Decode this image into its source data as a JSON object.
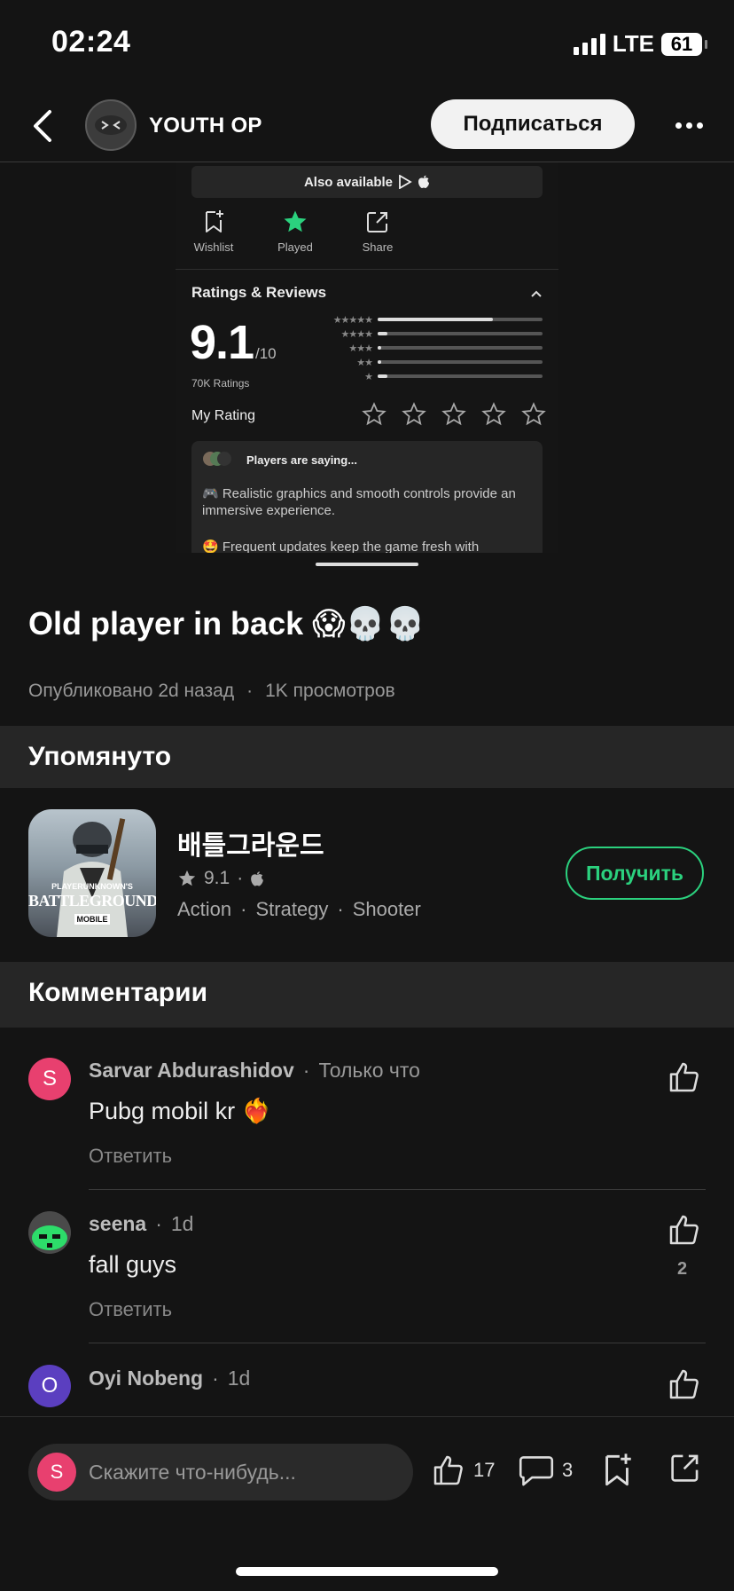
{
  "status_bar": {
    "time": "02:24",
    "network": "LTE",
    "battery": "61"
  },
  "header": {
    "channel_name": "YOUTH OP",
    "subscribe_label": "Подписаться"
  },
  "embed": {
    "also_available": "Also available",
    "actions": [
      {
        "label": "Wishlist",
        "icon": "bookmark-plus-icon"
      },
      {
        "label": "Played",
        "icon": "star-filled-icon"
      },
      {
        "label": "Share",
        "icon": "share-icon"
      }
    ],
    "ratings_title": "Ratings & Reviews",
    "score": "9.1",
    "score_of": "/10",
    "ratings_count": "70K  Ratings",
    "bars": [
      {
        "stars": "★★★★★",
        "fraction": 0.7
      },
      {
        "stars": "★★★★",
        "fraction": 0.06
      },
      {
        "stars": "★★★",
        "fraction": 0.02
      },
      {
        "stars": "★★",
        "fraction": 0.02
      },
      {
        "stars": "★",
        "fraction": 0.06
      }
    ],
    "my_rating_label": "My Rating",
    "players_saying": "Players are saying...",
    "saying_1": "🎮 Realistic graphics and smooth controls provide an immersive experience.",
    "saying_2": "🤩 Frequent updates keep the game fresh with"
  },
  "post": {
    "title": "Old player in back 😱💀💀",
    "published": "Опубликовано 2d назад",
    "views": "1K просмотров"
  },
  "mentioned": {
    "section_title": "Упомянуто",
    "game_name": "배틀그라운드",
    "rating": "9.1",
    "tags": [
      "Action",
      "Strategy",
      "Shooter"
    ],
    "get_label": "Получить",
    "icon_text_top": "PLAYERUNKNOWN'S",
    "icon_text_main": "BATTLEGROUNDS",
    "icon_text_sub": "MOBILE"
  },
  "comments_section": {
    "title": "Комментарии"
  },
  "comments": [
    {
      "initial": "S",
      "name": "Sarvar Abdurashidov",
      "time": "Только что",
      "text": "Pubg mobil kr ❤️‍🔥",
      "reply": "Ответить",
      "likes": ""
    },
    {
      "initial": "",
      "name": "seena",
      "time": "1d",
      "text": "fall guys",
      "reply": "Ответить",
      "likes": "2"
    },
    {
      "initial": "O",
      "name": "Oyi Nobeng",
      "time": "1d",
      "text": "",
      "reply": "",
      "likes": ""
    }
  ],
  "bottom_bar": {
    "user_initial": "S",
    "placeholder": "Скажите что-нибудь...",
    "like_count": "17",
    "comment_count": "3"
  },
  "colors": {
    "accent_green": "#2bd17e",
    "avatar_pink": "#e8406f",
    "avatar_purple": "#5b3fc0"
  }
}
